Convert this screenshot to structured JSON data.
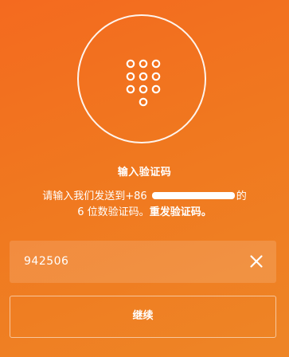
{
  "icon": "keypad-icon",
  "title": "输入验证码",
  "description": {
    "line1_prefix": "请输入我们发送到+86 ",
    "line1_suffix": "的",
    "line2_prefix": "6 位数验证码。",
    "resend_link": "重发验证码。"
  },
  "code_input": {
    "value": "942506",
    "clear_icon": "close-icon"
  },
  "continue_button": {
    "label": "继续"
  },
  "colors": {
    "background_start": "#f46a1f",
    "background_end": "#ee8526",
    "foreground": "#ffffff"
  }
}
